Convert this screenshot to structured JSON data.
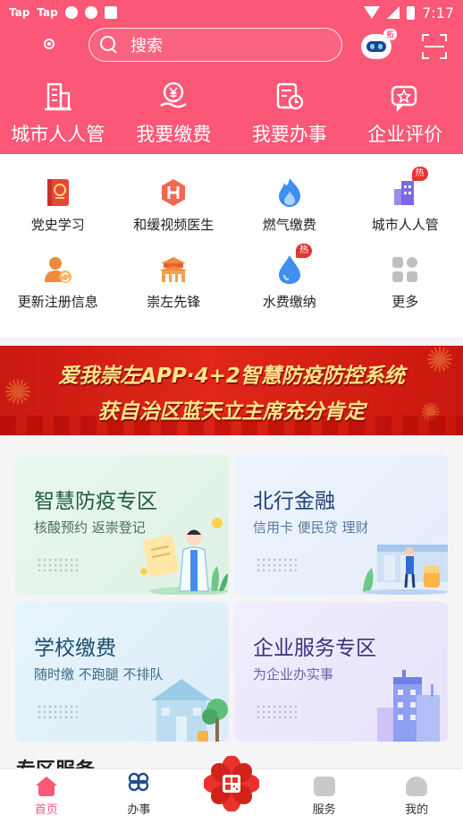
{
  "status_bar": {
    "app_badges": [
      "Tap",
      "Tap"
    ],
    "time": "7:17"
  },
  "header": {
    "search_placeholder": "搜索",
    "assistant_badge": "拓",
    "nav": [
      {
        "label": "城市人人管",
        "icon": "building-icon"
      },
      {
        "label": "我要缴费",
        "icon": "yen-hand-icon"
      },
      {
        "label": "我要办事",
        "icon": "document-clock-icon"
      },
      {
        "label": "企业评价",
        "icon": "star-chat-icon"
      }
    ]
  },
  "quick_services": [
    {
      "label": "党史学习",
      "icon": "party-book-icon"
    },
    {
      "label": "和缓视频医生",
      "icon": "hospital-hexagon-icon"
    },
    {
      "label": "燃气缴费",
      "icon": "flame-icon"
    },
    {
      "label": "城市人人管",
      "icon": "city-building-icon",
      "badge": "热"
    },
    {
      "label": "更新注册信息",
      "icon": "user-update-icon"
    },
    {
      "label": "崇左先锋",
      "icon": "pavilion-icon"
    },
    {
      "label": "水费缴纳",
      "icon": "water-drop-icon",
      "badge": "热"
    },
    {
      "label": "更多",
      "icon": "more-grid-icon"
    }
  ],
  "banner": {
    "line1": "爱我崇左APP·4+2智慧防疫防控系统",
    "line2": "获自治区蓝天立主席充分肯定"
  },
  "cards": [
    {
      "title": "智慧防疫专区",
      "subtitle": "核酸预约 返崇登记"
    },
    {
      "title": "北行金融",
      "subtitle": "信用卡 便民贷 理财"
    },
    {
      "title": "学校缴费",
      "subtitle": "随时缴 不跑腿 不排队"
    },
    {
      "title": "企业服务专区",
      "subtitle": "为企业办实事"
    }
  ],
  "section_peek": "专区服务",
  "colors": {
    "brand": "#fb5777",
    "hot": "#e83232",
    "banner_red": "#d8200f"
  },
  "tabbar": [
    {
      "label": "首页",
      "icon": "home-icon",
      "active": true
    },
    {
      "label": "办事",
      "icon": "knot-icon"
    },
    {
      "label": "",
      "icon": "qr-flower-icon"
    },
    {
      "label": "服务",
      "icon": "service-icon"
    },
    {
      "label": "我的",
      "icon": "person-icon"
    }
  ]
}
